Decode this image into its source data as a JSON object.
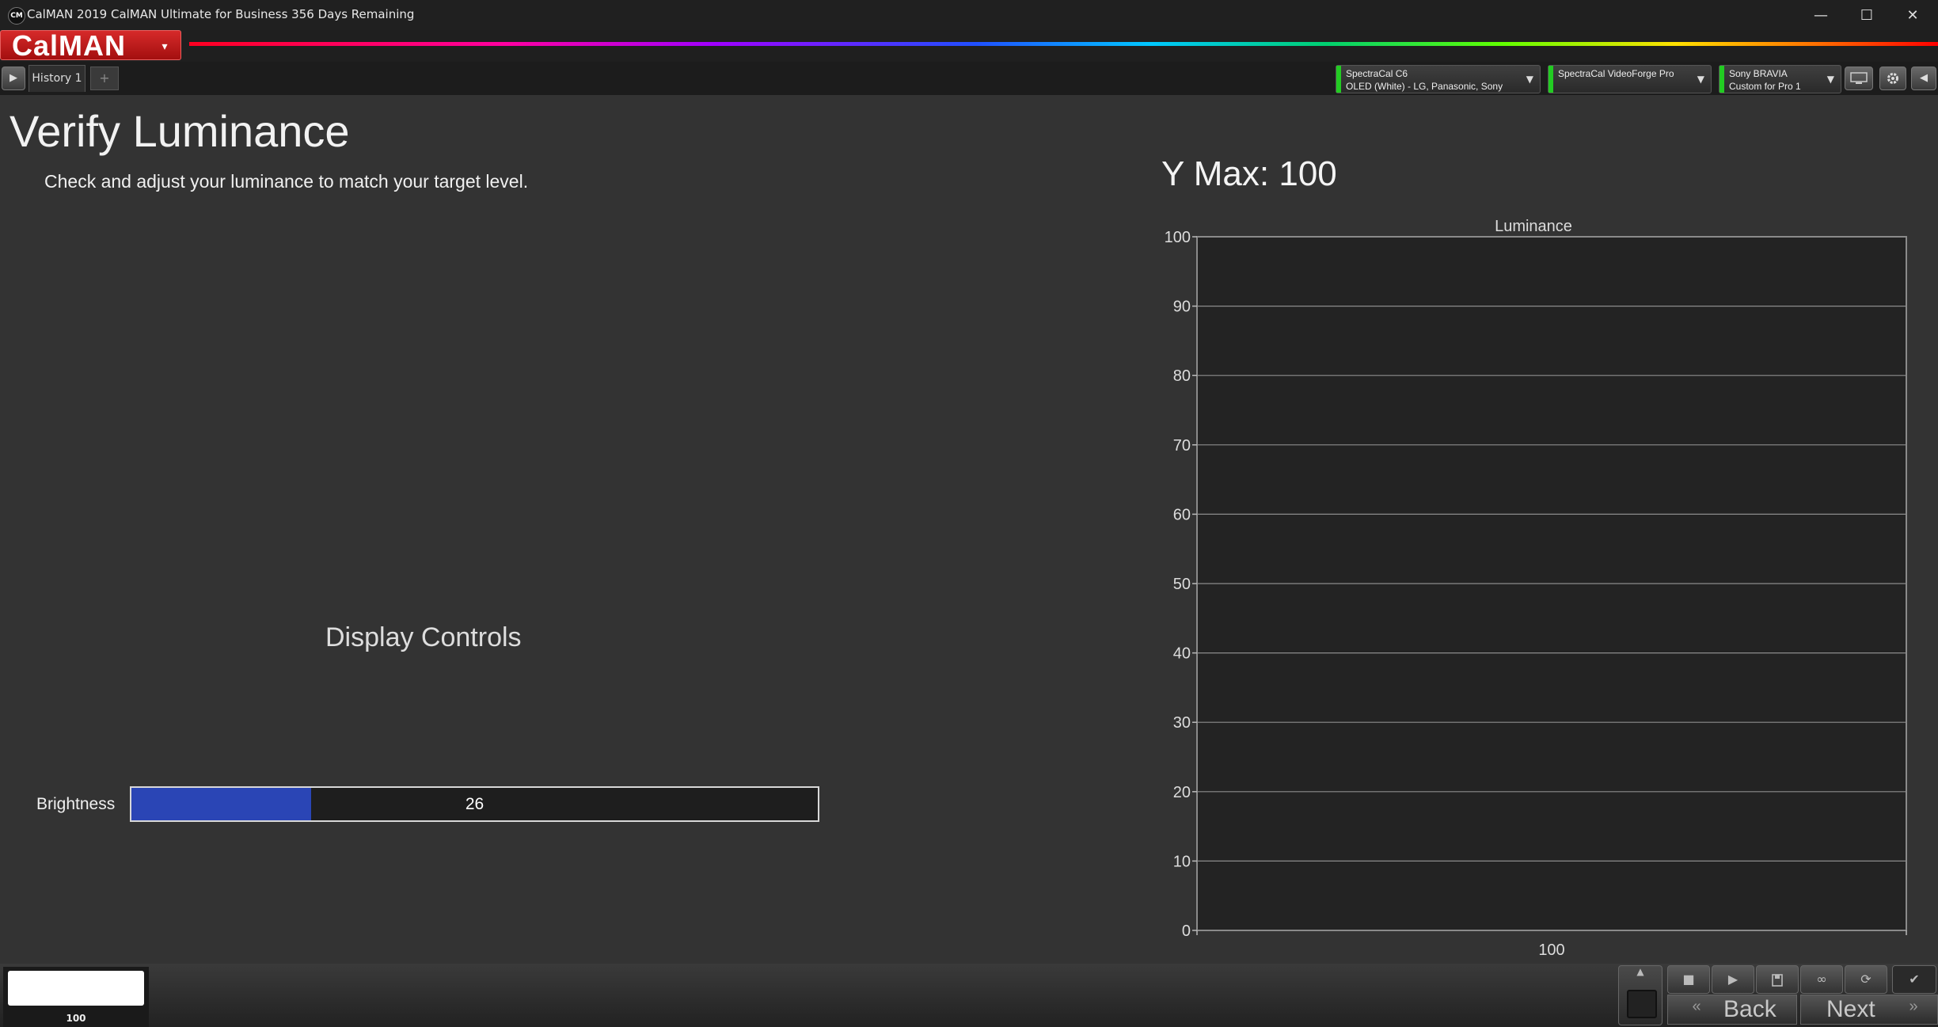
{
  "window": {
    "icon_text": "CM",
    "title": "CalMAN 2019 CalMAN Ultimate for Business 356 Days Remaining",
    "minimize_glyph": "—",
    "maximize_glyph": "☐",
    "close_glyph": "✕"
  },
  "brand": {
    "logo": "CalMAN",
    "logo_caret": "▾"
  },
  "tabs": {
    "play_glyph": "▶",
    "items": [
      {
        "label": "History 1"
      }
    ],
    "add_glyph": "+"
  },
  "devices": [
    {
      "line1": "SpectraCal C6",
      "line2": "OLED (White) - LG, Panasonic, Sony",
      "status_color": "#22cc22"
    },
    {
      "line1": "SpectraCal VideoForge Pro",
      "line2": "",
      "status_color": "#22cc22"
    },
    {
      "line1": "Sony BRAVIA",
      "line2": "Custom for Pro 1",
      "status_color": "#22cc22"
    }
  ],
  "toolbar_icons": [
    "monitor-icon",
    "gear-icon",
    "collapse-left-icon"
  ],
  "page": {
    "title": "Verify Luminance",
    "description": "Check and adjust your luminance to match your target level."
  },
  "display_controls": {
    "title": "Display Controls",
    "brightness": {
      "label": "Brightness",
      "value": "26",
      "fill_fraction": 0.262,
      "fill_color": "#2a45b5"
    }
  },
  "ymax_label": "Y Max: 100",
  "chart_data": {
    "type": "bar",
    "title": "Luminance",
    "categories": [
      "100"
    ],
    "values": [],
    "ylim": [
      0,
      100
    ],
    "yticks": [
      "0",
      "10",
      "20",
      "30",
      "40",
      "50",
      "60",
      "70",
      "80",
      "90",
      "100"
    ],
    "grid": true,
    "xlabel": "",
    "ylabel": ""
  },
  "bottom": {
    "thumbnail_label": "100",
    "controls": [
      "stop-icon",
      "play-icon",
      "save-icon",
      "loop-icon",
      "refresh-icon",
      "check-icon"
    ],
    "back_label": "Back",
    "next_label": "Next"
  },
  "accent_color": "#c81d1d"
}
